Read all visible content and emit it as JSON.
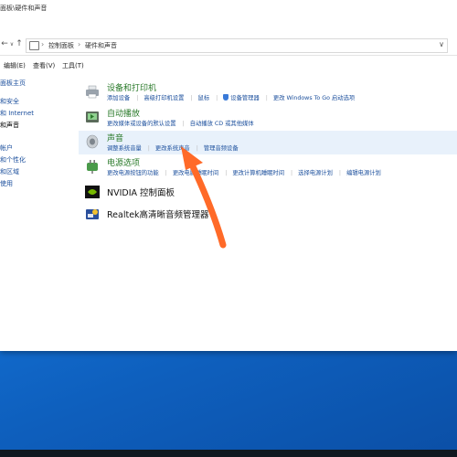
{
  "window": {
    "title": "面板\\硬件和声音"
  },
  "nav": {
    "back": "←",
    "forward": "→",
    "dropdown": "∨",
    "up": "↑"
  },
  "address": {
    "crumbs": [
      "控制面板",
      "硬件和声音"
    ],
    "sep": "›"
  },
  "menu": [
    "编辑(E)",
    "查看(V)",
    "工具(T)"
  ],
  "sidebar": [
    {
      "label": "面板主页",
      "bold": false
    },
    {
      "label": "和安全",
      "bold": false
    },
    {
      "label": "和 Internet",
      "bold": false
    },
    {
      "label": "和声音",
      "bold": true
    },
    {
      "label": "帐户",
      "bold": false
    },
    {
      "label": "和个性化",
      "bold": false
    },
    {
      "label": "和区域",
      "bold": false
    },
    {
      "label": "使用",
      "bold": false
    }
  ],
  "categories": [
    {
      "id": "devices",
      "title": "设备和打印机",
      "links": [
        "添加设备",
        "高级打印机设置",
        "鼠标",
        "设备管理器",
        "更改 Windows To Go 启动选项"
      ]
    },
    {
      "id": "autoplay",
      "title": "自动播放",
      "links": [
        "更改媒体或设备的默认设置",
        "自动播放 CD 或其他媒体"
      ]
    },
    {
      "id": "sound",
      "title": "声音",
      "highlight": true,
      "links": [
        "调整系统音量",
        "更改系统声音",
        "管理音频设备"
      ]
    },
    {
      "id": "power",
      "title": "电源选项",
      "links": [
        "更改电源按钮的功能",
        "更改电脑睡眠时间",
        "更改计算机睡眠时间",
        "选择电源计划",
        "编辑电源计划"
      ]
    },
    {
      "id": "nvidia",
      "title": "NVIDIA 控制面板",
      "links": []
    },
    {
      "id": "realtek",
      "title": "Realtek高清晰音频管理器",
      "links": []
    }
  ],
  "colors": {
    "link": "#1a4e9c",
    "category_title": "#2a7a2a",
    "highlight": "#e8f1fb",
    "arrow": "#ff6a28",
    "desktop": "#1473d8"
  }
}
